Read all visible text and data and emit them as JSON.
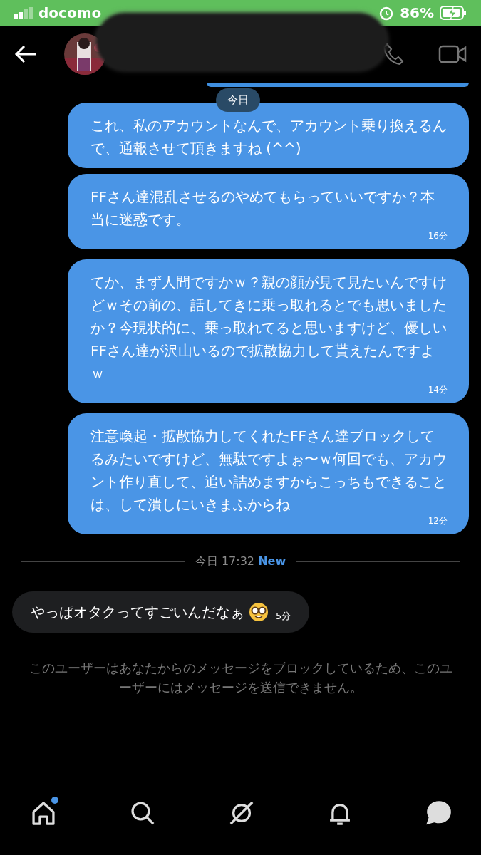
{
  "status_bar": {
    "carrier": "docomo",
    "battery": "86%",
    "charging": true
  },
  "date_badge": "今日",
  "messages": [
    {
      "kind": "sent",
      "text": "これ、私のアカウントなんで、アカウント乗り換えるんで、通報させて頂きますね (^^)"
    },
    {
      "kind": "sent",
      "text": "FFさん達混乱させるのやめてもらっていいですか？本当に迷惑です。",
      "time": "16分"
    },
    {
      "kind": "sent",
      "text": "てか、まず人間ですかｗ？親の顔が見て見たいんですけどｗその前の、話してきに乗っ取れるとでも思いましたか？今現状的に、乗っ取れてると思いますけど、優しいFFさん達が沢山いるので拡散協力して貰えたんですよｗ",
      "time": "14分"
    },
    {
      "kind": "sent",
      "text": "注意喚起・拡散協力してくれたFFさん達ブロックしてるみたいですけど、無駄ですよぉ〜ｗ何回でも、アカウント作り直して、追い詰めますからこっちもできることは、して潰しにいきまふからね",
      "time": "12分"
    }
  ],
  "divider": {
    "label": "今日 17:32",
    "badge": "New"
  },
  "received": [
    {
      "kind": "received",
      "text": "やっぱオタクってすごいんだなぁ",
      "time": "5分"
    }
  ],
  "notice": "このユーザーはあなたからのメッセージをブロックしているため、このユーザーにはメッセージを送信できません。",
  "nav": [
    {
      "selected": false,
      "dot": true
    },
    {
      "selected": false,
      "dot": false
    },
    {
      "selected": false,
      "dot": false
    },
    {
      "selected": false,
      "dot": false
    },
    {
      "selected": true,
      "dot": false
    }
  ]
}
